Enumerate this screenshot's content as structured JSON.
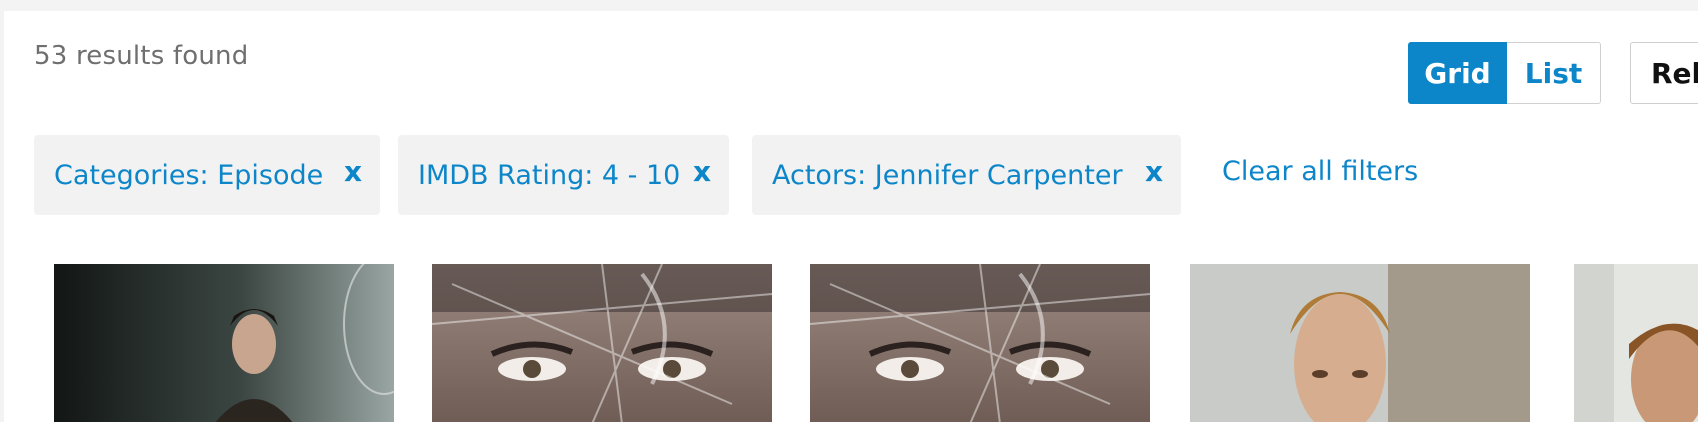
{
  "results": {
    "count_text": "53 results found"
  },
  "view_toggle": {
    "grid_label": "Grid",
    "list_label": "List",
    "selected": "Grid"
  },
  "sort": {
    "visible_text": "Rel"
  },
  "filters": [
    {
      "label": "Categories: Episode",
      "remove": "x"
    },
    {
      "label": "IMDB Rating: 4 - 10",
      "remove": "x"
    },
    {
      "label": "Actors: Jennifer Carpenter",
      "remove": "x"
    }
  ],
  "clear_all": "Clear all filters",
  "thumbnails": [
    {
      "description": "episode-still"
    },
    {
      "description": "episode-poster-face"
    },
    {
      "description": "episode-poster-face"
    },
    {
      "description": "episode-still"
    },
    {
      "description": "episode-still"
    }
  ],
  "colors": {
    "accent": "#0d86c9",
    "chip_bg": "#f2f2f2",
    "text_muted": "#6f6f6f"
  }
}
